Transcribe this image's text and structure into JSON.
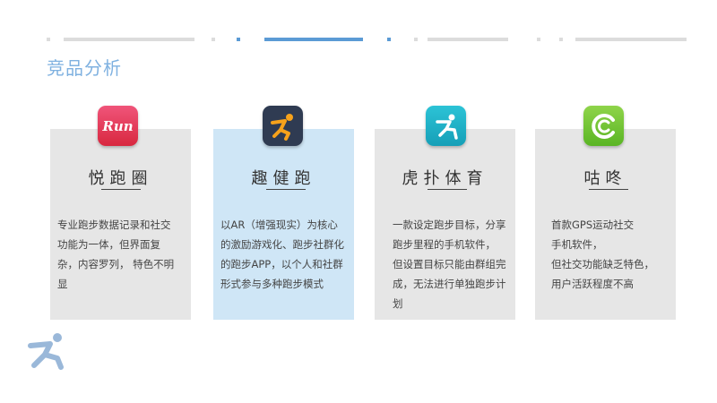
{
  "page": {
    "title": "竞品分析"
  },
  "colors": {
    "accent": "#5b9bd5",
    "title": "#7fb1e0",
    "card": "#e6e6e6",
    "card_highlight": "#cfe6f6"
  },
  "cards": [
    {
      "name": "悦跑圈",
      "icon": "run-logo-icon",
      "icon_text": "Run",
      "desc": [
        "专业跑步数据记录和社交",
        "功能为一体，但界面复",
        "杂，内容罗列， 特色不明",
        "显"
      ]
    },
    {
      "name": "趣健跑",
      "icon": "runner-orange-icon",
      "desc": [
        "以AR（增强现实）为核心",
        "的激励游戏化、跑步社群化",
        "的跑步APP，以个人和社群",
        "形式参与多种跑步模式"
      ]
    },
    {
      "name": "虎扑体育",
      "icon": "runner-teal-icon",
      "desc": [
        "一款设定跑步目标，分享",
        "跑步里程的手机软件，",
        "但设置目标只能由群组完",
        "成，无法进行单独跑步计",
        "划"
      ]
    },
    {
      "name": "咕咚",
      "icon": "codoon-green-icon",
      "desc": [
        "首款GPS运动社交",
        "手机软件，",
        "但社交功能缺乏特色，",
        "用户活跃程度不高"
      ]
    }
  ]
}
